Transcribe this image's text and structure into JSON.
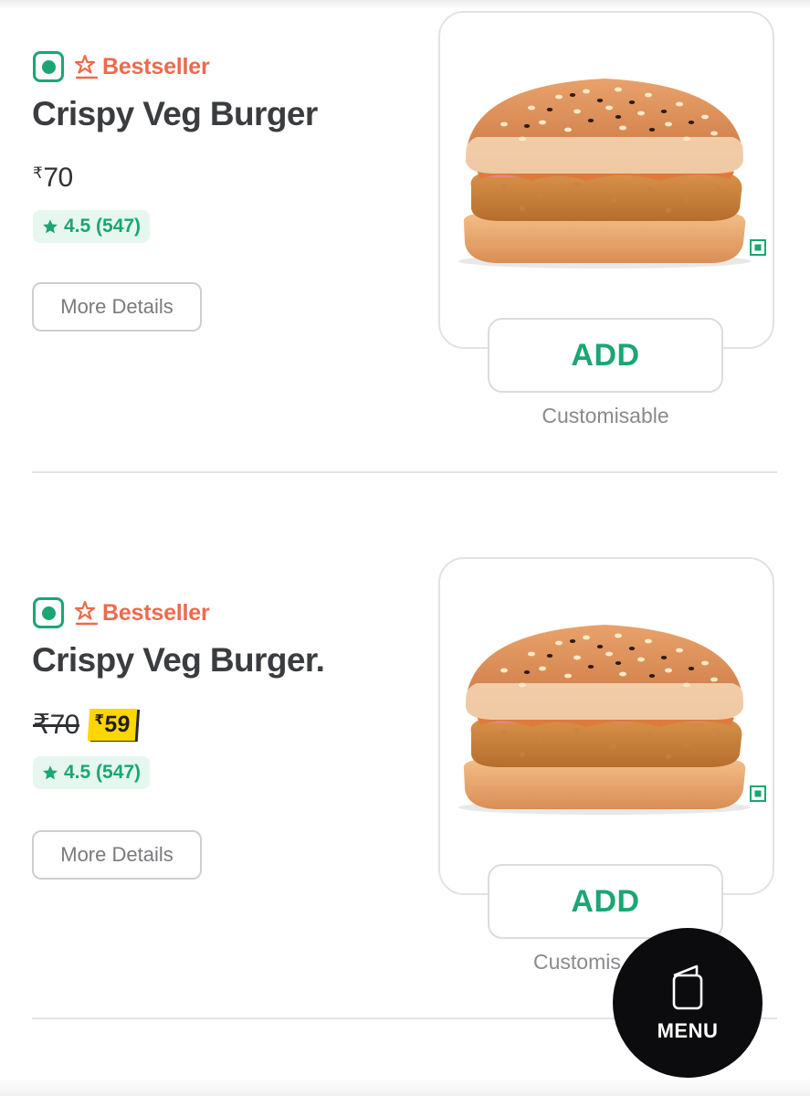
{
  "items": [
    {
      "badge": "Bestseller",
      "name": "Crispy Veg Burger",
      "price_symbol": "₹",
      "price": "70",
      "rating": "4.5 (547)",
      "more_details_label": "More Details",
      "add_label": "ADD",
      "customisable_label": "Customisable"
    },
    {
      "badge": "Bestseller",
      "name": "Crispy Veg Burger.",
      "old_price": "₹70",
      "new_price_symbol": "₹",
      "new_price": "59",
      "rating": "4.5 (547)",
      "more_details_label": "More Details",
      "add_label": "ADD",
      "customisable_label": "Customis"
    }
  ],
  "menu_fab": {
    "label": "MENU",
    "icon": "menu-book-icon"
  },
  "colors": {
    "veg_green": "#1ba672",
    "bestseller_orange": "#ee6a4d",
    "rating_bg": "#e6f7f0",
    "discount_yellow": "#ffd600",
    "fab_bg": "#0c0c0e"
  }
}
